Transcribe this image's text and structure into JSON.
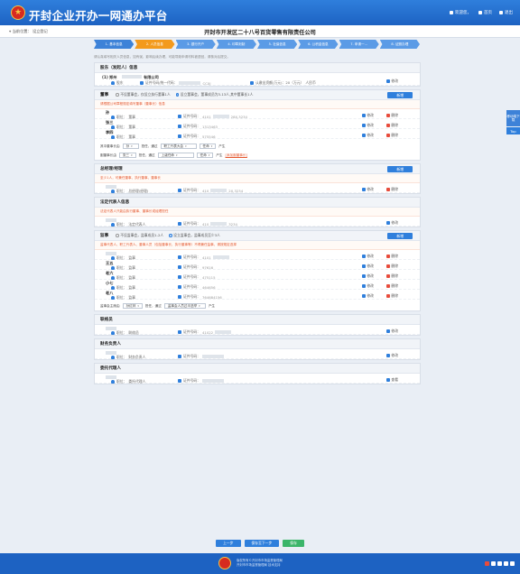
{
  "header": {
    "brand": "开封企业开办一网通办平台",
    "username": "欢迎您，",
    "home": "首页",
    "exit": "退出"
  },
  "crumb": {
    "location": "当前位置：",
    "page": "设立登记"
  },
  "company_name": "开封市开发区二十八号百货零售有限责任公司",
  "steps": [
    "1. 基本信息",
    "2. 人员信息",
    "3. 银行开户",
    "4. 印章刻制",
    "5. 社保信息",
    "6. 公积金信息",
    "7. 申请一...",
    "8. 证照办理"
  ],
  "notice": "请认真填写相关人员信息，如有误，影响后续办理，可能导致申请材料被退回，请核对后提交。",
  "shareholders": {
    "title": "股东（发起人）信息",
    "items": [
      {
        "index": "(1)",
        "name": "郑州",
        "name_suffix": "有限公司",
        "role": "股东",
        "id_label": "证件号码/统一代码：",
        "id_value": "CCXJ",
        "capital_label": "认缴出资额(万元)：20（万元）",
        "pct": "人民币",
        "edit": "修改"
      }
    ]
  },
  "directors": {
    "title": "董事",
    "radios": [
      "不设董事会，仅设立执行董事1人",
      "设立董事会，董事成员为3-13人,其中董事长1人"
    ],
    "hint": "请根据公司章程规定填写董事（董事长）信息",
    "add": "新增",
    "rows": [
      {
        "name": "孙",
        "role": "董事",
        "id": "4101",
        "id_tail": "28X,3234"
      },
      {
        "name": "张三",
        "role": "董事",
        "id": "1313463",
        "id_tail": ""
      },
      {
        "name": "李四",
        "role": "董事",
        "id": "575546",
        "id_tail": ""
      }
    ],
    "edit": "修改",
    "delete": "删除",
    "chair_row": {
      "label": "其中董事长由",
      "sel1": "孙",
      "mid": "担任，通过",
      "sel2": "职工代表大会",
      "sel3": "任命",
      "end": "产生"
    },
    "vice_row": {
      "label": "副董事长由",
      "sel1": "张三",
      "mid": "担任，通过",
      "sel2": "上级任命",
      "sel3": "任命",
      "end": "产生",
      "link": "[添加副董事长]"
    }
  },
  "manager": {
    "title": "总经理/经理",
    "hint": "至少1人，可兼任董事、执行董事、董事长",
    "add": "新增",
    "row": {
      "name": "",
      "role": "总经理(经理)",
      "id": "410",
      "id_tail": "2X,3234"
    }
  },
  "legal_rep": {
    "title": "法定代表人信息",
    "hint": "法定代表人只能由执行董事、董事长或经理担任",
    "row": {
      "name": "",
      "role": "法定代表人",
      "id": "410",
      "id_tail": "3234"
    },
    "edit": "修改"
  },
  "supervisors": {
    "title": "监事",
    "radios": [
      "不设监事会，监事成员1-2人",
      "设立监事会，监事成员至少3人"
    ],
    "hint": "监事代表人、职工代表人、董事人员（包括董事长、执行董事等）不得兼任监事，请按规定选择",
    "add": "新增",
    "rows": [
      {
        "name": "",
        "role": "监事",
        "id": "4101"
      },
      {
        "name": "王五",
        "role": "监事",
        "id": "97616"
      },
      {
        "name": "老六",
        "role": "监事",
        "id": "475115"
      },
      {
        "name": "小七",
        "role": "监事",
        "id": "464656"
      },
      {
        "name": "老八",
        "role": "监事",
        "id": "764684156"
      }
    ],
    "edit": "修改",
    "delete": "删除",
    "chair_row": {
      "label": "监事会主席由",
      "sel1": "孙红林",
      "mid": "担任，通过",
      "sel2": "监事会人员过半选举",
      "end": "产生"
    }
  },
  "liaison": {
    "title": "联络员",
    "row": {
      "name": "",
      "role": "联络员",
      "id": "41022"
    }
  },
  "finance": {
    "title": "财务负责人",
    "row": {
      "name": "",
      "role": "财务负责人",
      "id": ""
    }
  },
  "agent": {
    "title": "委托代理人",
    "row": {
      "name": "",
      "role": "委托代理人",
      "id": ""
    },
    "view": "查看"
  },
  "buttons": {
    "prev": "上一步",
    "save": "保存至下一步",
    "next": "保存"
  },
  "footer": {
    "line1": "版权所有©开封市市场监督管理局",
    "line2": "开封市市场监督管理局 技术支持"
  },
  "side": {
    "app": "移动端下载",
    "top": "Top"
  },
  "labels": {
    "id_prefix": "证件号码：",
    "role_prefix": "职位："
  }
}
